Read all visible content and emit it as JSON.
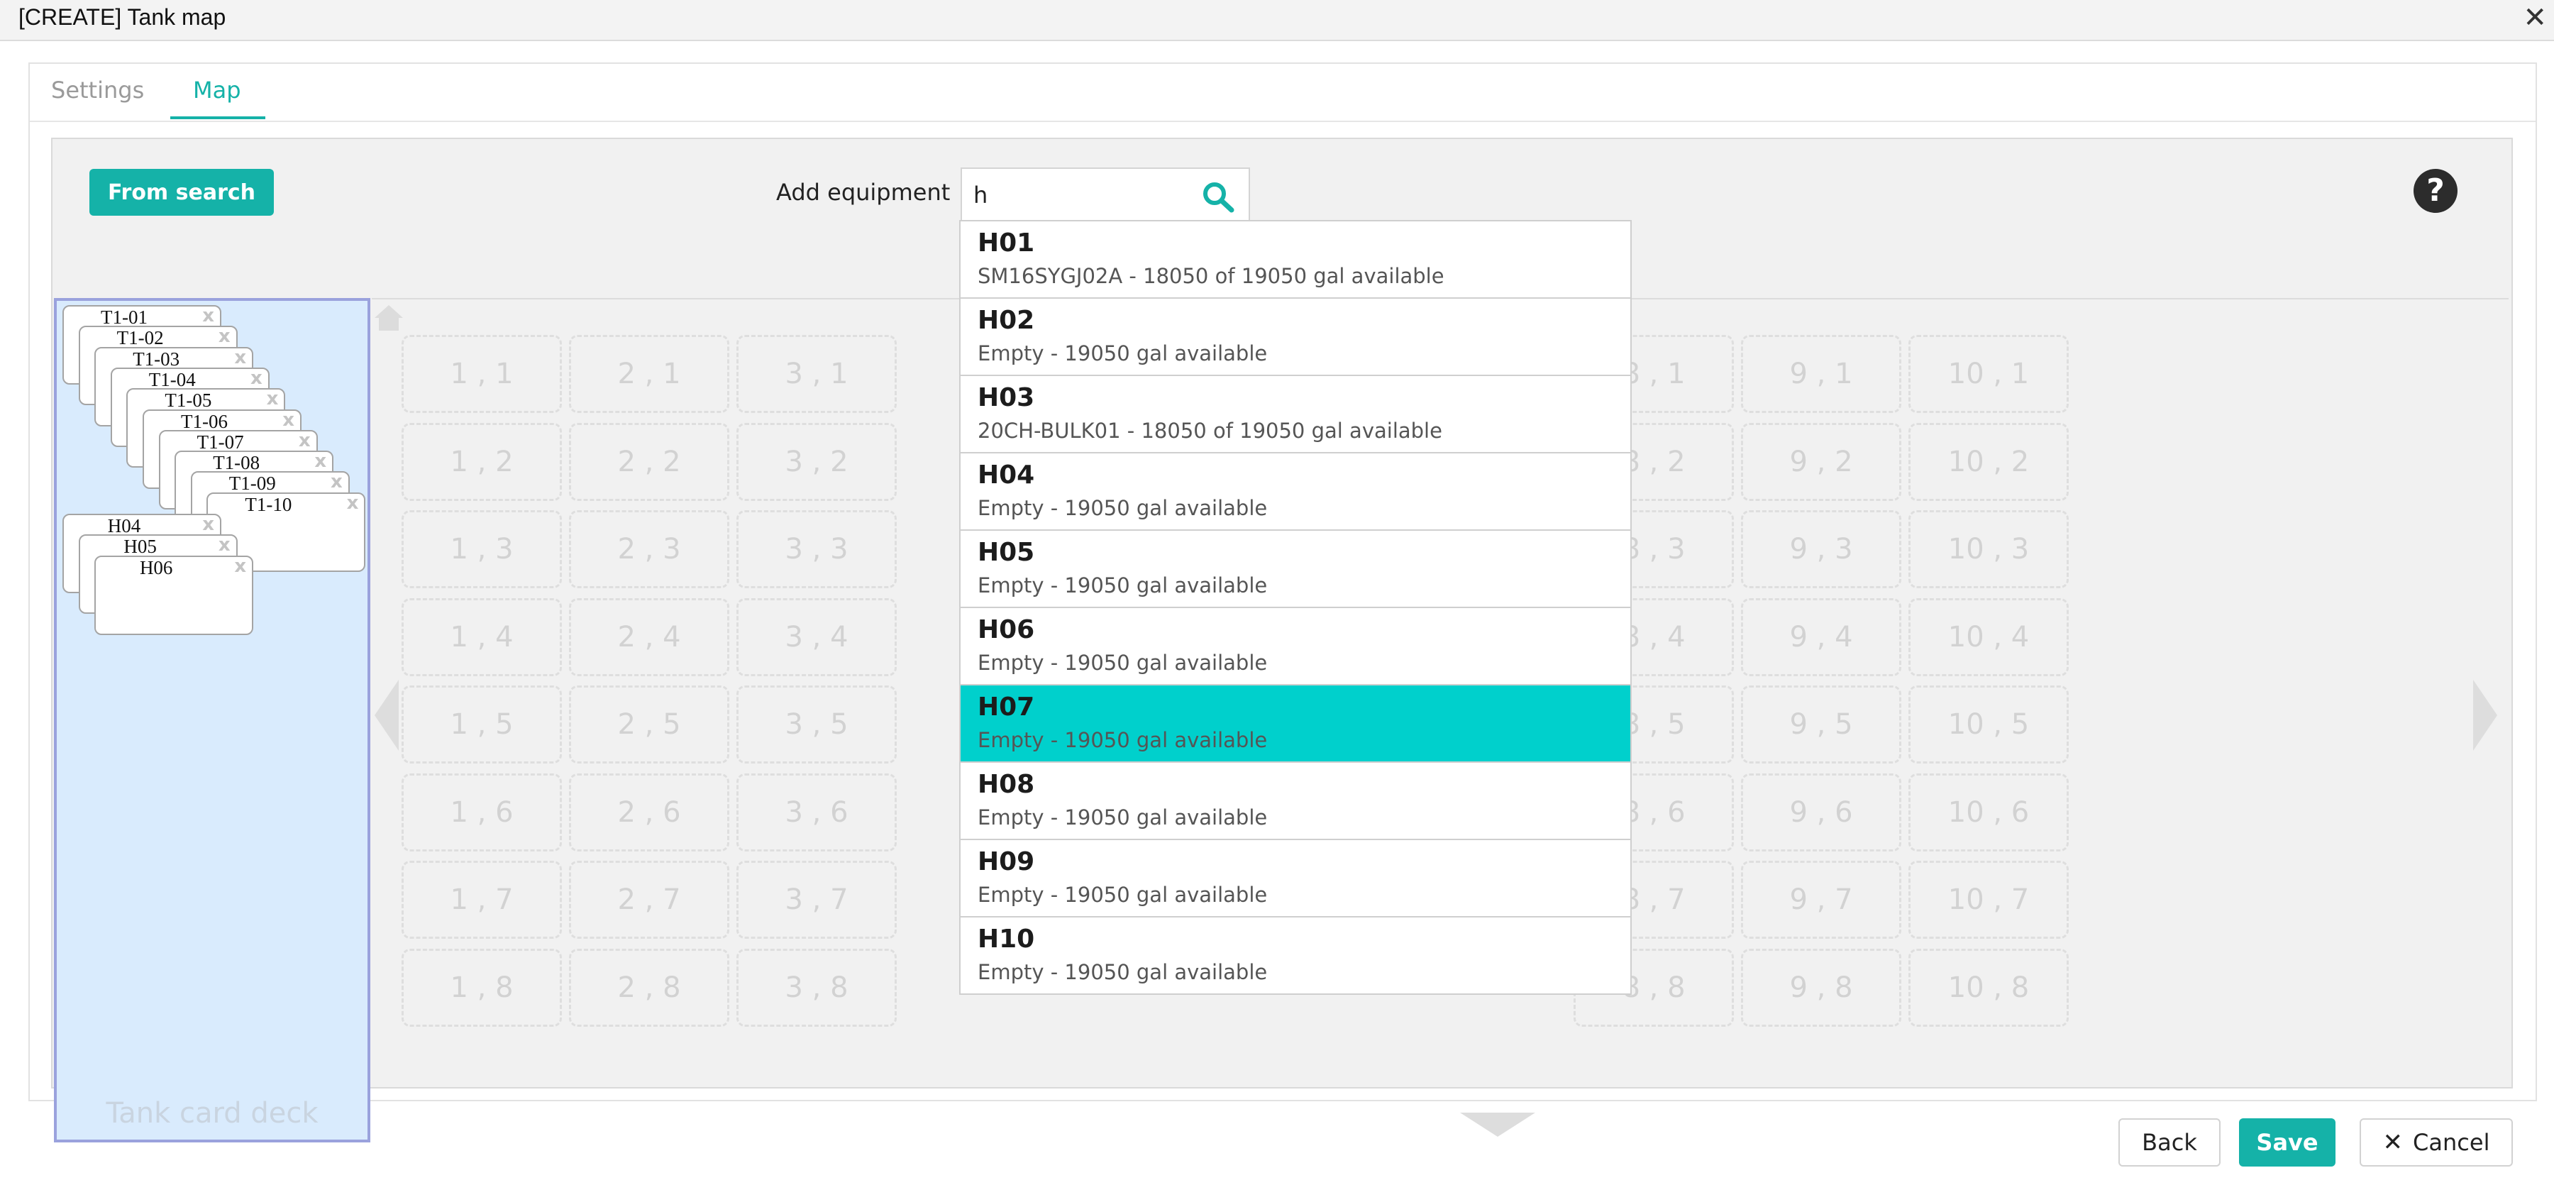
{
  "window": {
    "title": "[CREATE] Tank map",
    "close_icon": "close-icon"
  },
  "tabs": [
    {
      "label": "Settings",
      "active": false
    },
    {
      "label": "Map",
      "active": true
    }
  ],
  "toolbar": {
    "from_search_label": "From search",
    "add_equipment_label": "Add equipment",
    "search_value": "h",
    "search_icon": "search-icon",
    "help_icon": "question-icon",
    "help_text": "?"
  },
  "deck": {
    "label": "Tank card deck",
    "cards": [
      {
        "label": "T1-01",
        "remove": "x"
      },
      {
        "label": "T1-02",
        "remove": "x"
      },
      {
        "label": "T1-03",
        "remove": "x"
      },
      {
        "label": "T1-04",
        "remove": "x"
      },
      {
        "label": "T1-05",
        "remove": "x"
      },
      {
        "label": "T1-06",
        "remove": "x"
      },
      {
        "label": "T1-07",
        "remove": "x"
      },
      {
        "label": "T1-08",
        "remove": "x"
      },
      {
        "label": "T1-09",
        "remove": "x"
      },
      {
        "label": "T1-10",
        "remove": "x"
      }
    ],
    "cards_b": [
      {
        "label": "H04",
        "remove": "x"
      },
      {
        "label": "H05",
        "remove": "x"
      },
      {
        "label": "H06",
        "remove": "x"
      }
    ]
  },
  "grid": {
    "columns": 10,
    "rows": 8,
    "visible_columns": [
      1,
      2,
      3,
      8,
      9,
      10
    ],
    "slot_separator": " , "
  },
  "dropdown": {
    "items": [
      {
        "name": "H01",
        "detail": "SM16SYGJ02A - 18050 of 19050 gal available",
        "active": false
      },
      {
        "name": "H02",
        "detail": "Empty - 19050 gal available",
        "active": false
      },
      {
        "name": "H03",
        "detail": "20CH-BULK01 - 18050 of 19050 gal available",
        "active": false
      },
      {
        "name": "H04",
        "detail": "Empty - 19050 gal available",
        "active": false
      },
      {
        "name": "H05",
        "detail": "Empty - 19050 gal available",
        "active": false
      },
      {
        "name": "H06",
        "detail": "Empty - 19050 gal available",
        "active": false
      },
      {
        "name": "H07",
        "detail": "Empty - 19050 gal available",
        "active": true
      },
      {
        "name": "H08",
        "detail": "Empty - 19050 gal available",
        "active": false
      },
      {
        "name": "H09",
        "detail": "Empty - 19050 gal available",
        "active": false
      },
      {
        "name": "H10",
        "detail": "Empty - 19050 gal available",
        "active": false
      }
    ]
  },
  "footer": {
    "back_label": "Back",
    "save_label": "Save",
    "cancel_label": "Cancel"
  },
  "colors": {
    "accent": "#15b2a8",
    "active_row": "#00d0cc",
    "deck_bg": "#d9ebfd"
  }
}
